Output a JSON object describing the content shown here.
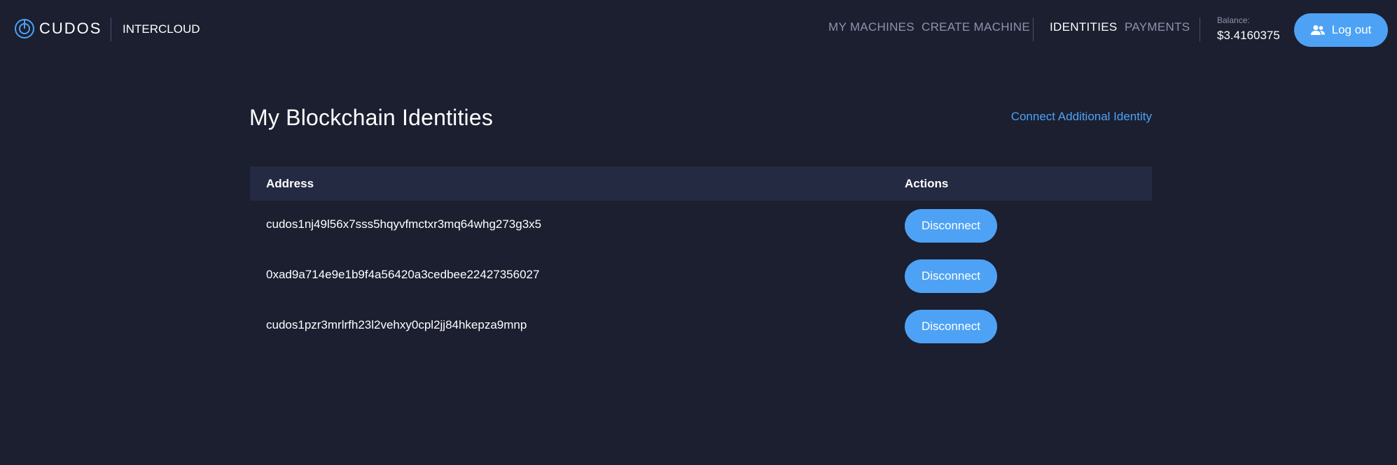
{
  "brand": {
    "logo_text": "CUDOS",
    "product_name": "INTERCLOUD"
  },
  "nav": {
    "items": [
      {
        "label": "MY MACHINES",
        "active": false
      },
      {
        "label": "CREATE MACHINE",
        "active": false
      },
      {
        "label": "IDENTITIES",
        "active": true
      },
      {
        "label": "PAYMENTS",
        "active": false
      }
    ]
  },
  "balance": {
    "label": "Balance:",
    "value": "$3.4160375"
  },
  "logout": {
    "label": "Log out",
    "icon": "users-icon"
  },
  "page": {
    "title": "My Blockchain Identities",
    "connect_link": "Connect Additional Identity"
  },
  "table": {
    "columns": [
      "Address",
      "Actions"
    ],
    "rows": [
      {
        "address": "cudos1nj49l56x7sss5hqyvfmctxr3mq64whg273g3x5",
        "action": "Disconnect"
      },
      {
        "address": "0xad9a714e9e1b9f4a56420a3cedbee22427356027",
        "action": "Disconnect"
      },
      {
        "address": "cudos1pzr3mrlrfh23l2vehxy0cpl2jj84hkepza9mnp",
        "action": "Disconnect"
      }
    ]
  },
  "colors": {
    "background": "#1b1f30",
    "accent": "#4ea2f5",
    "table_header": "#242a42",
    "muted_text": "#8d93ac"
  }
}
